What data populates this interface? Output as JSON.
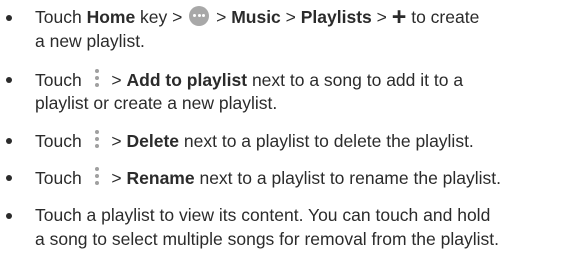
{
  "items": [
    {
      "line1": {
        "t1": "Touch ",
        "b1": "Home",
        "t2": " key > ",
        "t3": " > ",
        "b2": "Music",
        "t4": " > ",
        "b3": "Playlists",
        "t5": " > ",
        "t6": " to create"
      },
      "line2": "a new playlist."
    },
    {
      "line1": {
        "t1": "Touch ",
        "t2": " > ",
        "b1": "Add to playlist",
        "t3": " next to a song to add it to a"
      },
      "line2": "playlist or create a new playlist."
    },
    {
      "line1": {
        "t1": "Touch ",
        "t2": " > ",
        "b1": "Delete",
        "t3": " next to a playlist to delete the playlist."
      }
    },
    {
      "line1": {
        "t1": "Touch ",
        "t2": " > ",
        "b1": "Rename",
        "t3": " next to a playlist to rename the playlist."
      }
    },
    {
      "line1": "Touch a playlist to view its content. You can touch and hold",
      "line2": "a song to select multiple songs for removal from the playlist."
    }
  ],
  "icons": {
    "apps": "apps-grid-icon",
    "menu": "more-options-icon",
    "plus": "+"
  }
}
